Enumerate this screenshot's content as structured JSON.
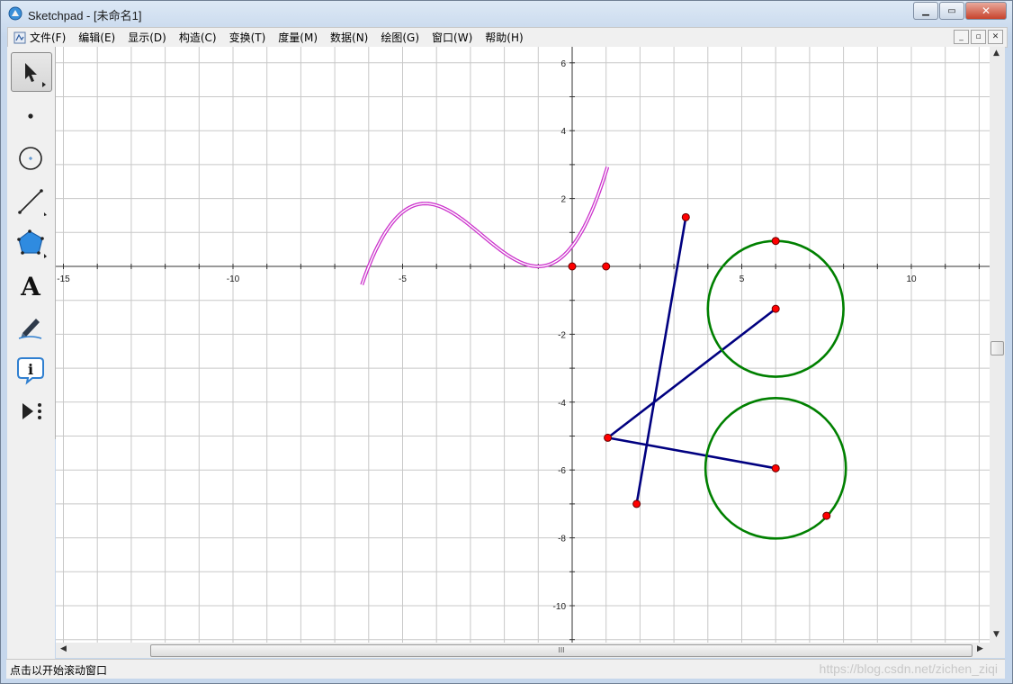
{
  "window": {
    "title": "Sketchpad  - [未命名1]",
    "minimize_label": "▁",
    "maximize_label": "▭",
    "close_label": "✕"
  },
  "menubar": {
    "items": [
      "文件(F)",
      "编辑(E)",
      "显示(D)",
      "构造(C)",
      "变换(T)",
      "度量(M)",
      "数据(N)",
      "绘图(G)",
      "窗口(W)",
      "帮助(H)"
    ],
    "mdi_minimize": "_",
    "mdi_restore": "▫",
    "mdi_close": "✕"
  },
  "toolbox": {
    "tools": [
      "arrow-select-icon",
      "point-icon",
      "compass-circle-icon",
      "straightedge-icon",
      "polygon-icon",
      "text-tool-icon",
      "marker-icon",
      "information-icon",
      "custom-tool-icon"
    ],
    "active": "arrow-select-icon"
  },
  "graph": {
    "x_ticks": [
      "-15",
      "-10",
      "-5",
      "5",
      "10"
    ],
    "y_ticks": [
      "6",
      "4",
      "2",
      "-2",
      "-4",
      "-6",
      "-8",
      "-10"
    ],
    "curve_color": "#cc33cc",
    "segment_color": "#000080",
    "circle_color": "#008000",
    "point_color": "#ff0000"
  },
  "scrollbar": {
    "grip_label": "III"
  },
  "status": {
    "text": "点击以开始滚动窗口",
    "watermark": "https://blog.csdn.net/zichen_ziqi"
  }
}
